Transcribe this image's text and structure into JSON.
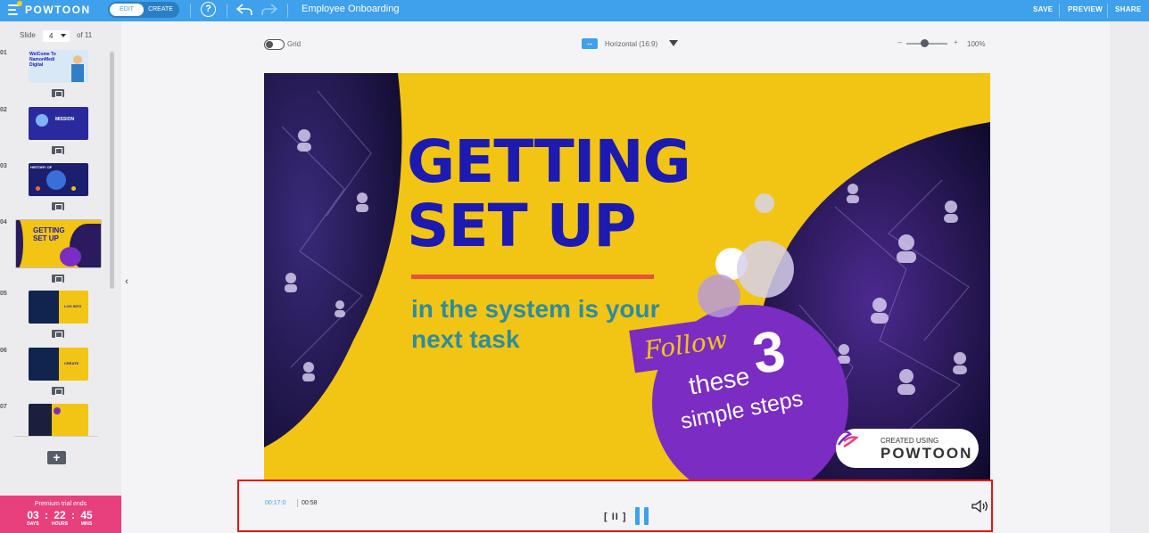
{
  "app": {
    "logo": "POWTOON",
    "mode_toggle": {
      "edit": "EDIT",
      "create": "CREATE"
    },
    "help_label": "?",
    "document_title": "Employee Onboarding",
    "actions": {
      "save": "SAVE",
      "preview": "PREVIEW",
      "share": "SHARE"
    }
  },
  "sidebar": {
    "slide_label": "Slide",
    "current_slide": "4",
    "of_total": "of 11",
    "thumbnails": [
      {
        "num": "01",
        "caption": "WelCome To NamonMedi Digital"
      },
      {
        "num": "02",
        "caption": "MISSION"
      },
      {
        "num": "03",
        "caption": "HISTORY OF"
      },
      {
        "num": "04",
        "caption": "GETTING SET UP"
      },
      {
        "num": "05",
        "caption": "LOG INTO"
      },
      {
        "num": "06",
        "caption": "CREATE"
      },
      {
        "num": "07",
        "caption": ""
      }
    ],
    "add_label": "+",
    "premium": {
      "title": "Premium trial ends",
      "days": "03",
      "hours": "22",
      "mins": "45",
      "days_label": "DAYS",
      "hours_label": "HOURS",
      "mins_label": "MINS"
    }
  },
  "toolbar": {
    "grid_label": "Grid",
    "ratio_label": "Horizontal (16:9)",
    "zoom_minus": "–",
    "zoom_plus": "+",
    "zoom_value": "100%",
    "zoom_level": 0.45
  },
  "slide": {
    "title_line1": "GETTING",
    "title_line2": "SET UP",
    "subtitle_line1": "in the system is your",
    "subtitle_line2": "next task",
    "follow": "Follow",
    "number": "3",
    "these": "these",
    "simple_steps": "simple steps",
    "badge_small": "CREATED USING",
    "badge_big": "POWTOON"
  },
  "playback": {
    "current_time": "00:17:0",
    "total_time": "00:58",
    "pause_small": "[ II ]"
  },
  "colors": {
    "topbar": "#3fa0ec",
    "slide_bg": "#f2c514",
    "title": "#1d1ab1",
    "subtitle": "#2e8c9e",
    "accent_purple": "#7b2cc2",
    "premium": "#e8407c",
    "highlight_border": "#e41616"
  }
}
